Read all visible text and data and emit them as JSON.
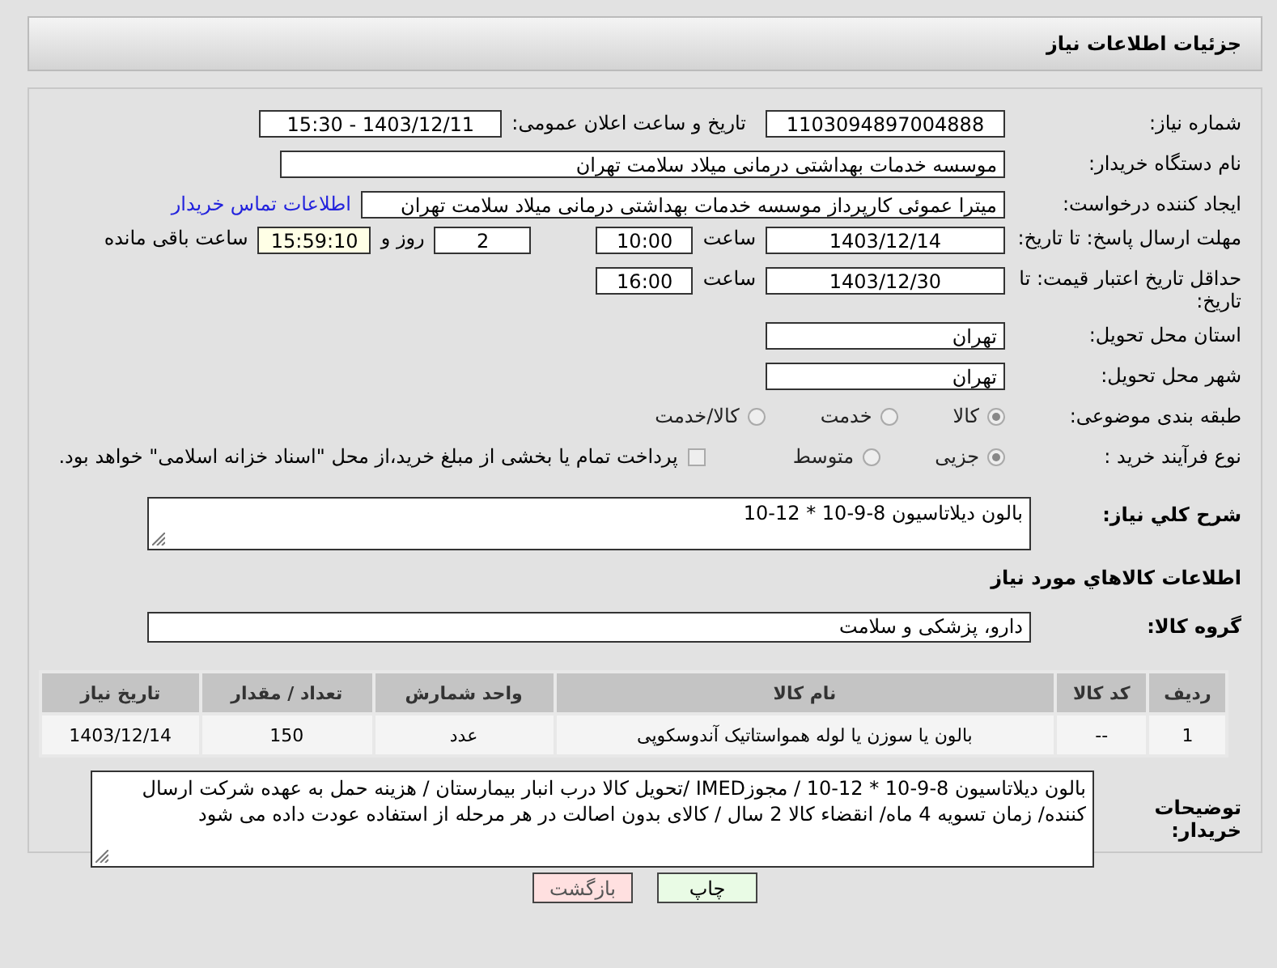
{
  "header": {
    "title": "جزئیات اطلاعات نیاز"
  },
  "need_number": {
    "label": "شماره نیاز:",
    "value": "1103094897004888"
  },
  "announce": {
    "label": "تاریخ و ساعت اعلان عمومی:",
    "value": "1403/12/11 - 15:30"
  },
  "buyer_org": {
    "label": "نام دستگاه خریدار:",
    "value": "موسسه خدمات بهداشتی درمانی میلاد سلامت تهران"
  },
  "creator": {
    "label": "ایجاد کننده درخواست:",
    "value": "میترا عموئی کارپرداز موسسه خدمات بهداشتی درمانی میلاد سلامت تهران",
    "link": "اطلاعات تماس خریدار"
  },
  "reply_deadline": {
    "label": "مهلت ارسال پاسخ: تا تاریخ:",
    "date": "1403/12/14",
    "time_label": "ساعت",
    "time": "10:00",
    "days": "2",
    "days_label": "روز و",
    "remaining": "15:59:10",
    "remaining_label": "ساعت باقی مانده"
  },
  "price_validity": {
    "label": "حداقل تاریخ اعتبار قیمت: تا تاریخ:",
    "date": "1403/12/30",
    "time_label": "ساعت",
    "time": "16:00"
  },
  "province": {
    "label": "استان محل تحویل:",
    "value": "تهران"
  },
  "city": {
    "label": "شهر محل تحویل:",
    "value": "تهران"
  },
  "category": {
    "label": "طبقه بندی موضوعی:",
    "options": [
      {
        "label": "کالا",
        "selected": true
      },
      {
        "label": "خدمت",
        "selected": false
      },
      {
        "label": "کالا/خدمت",
        "selected": false
      }
    ]
  },
  "process": {
    "label": "نوع فرآیند خرید :",
    "options": [
      {
        "label": "جزیی",
        "selected": true
      },
      {
        "label": "متوسط",
        "selected": false
      }
    ],
    "payment_checkbox": {
      "checked": false
    },
    "note": "پرداخت تمام یا بخشی از مبلغ خرید،از محل \"اسناد خزانه اسلامی\" خواهد بود."
  },
  "summary": {
    "label": "شرح کلي نياز:",
    "value": "بالون دیلاتاسیون 8-9-10 * 12-10"
  },
  "goods_title": "اطلاعات کالاهاي مورد نياز",
  "goods_group": {
    "label": "گروه کالا:",
    "value": "دارو، پزشکی و سلامت"
  },
  "table": {
    "columns": [
      "ردیف",
      "کد کالا",
      "نام کالا",
      "واحد شمارش",
      "تعداد / مقدار",
      "تاریخ نیاز"
    ],
    "rows": [
      [
        "1",
        "--",
        "بالون یا سوزن یا لوله همواستاتیک آندوسکوپی",
        "عدد",
        "150",
        "1403/12/14"
      ]
    ]
  },
  "buyer_notes": {
    "label": "توضیحات خریدار:",
    "value": "بالون دیلاتاسیون 8-9-10 * 12-10 / مجوزIMED /تحویل کالا درب انبار بیمارستان / هزینه حمل به عهده شرکت ارسال کننده/ زمان تسویه 4 ماه/ انقضاء کالا 2 سال / کالای بدون اصالت در هر مرحله از استفاده عودت داده می شود"
  },
  "buttons": [
    {
      "label": "چاپ",
      "kind": "print"
    },
    {
      "label": "بازگشت",
      "kind": "back"
    }
  ]
}
